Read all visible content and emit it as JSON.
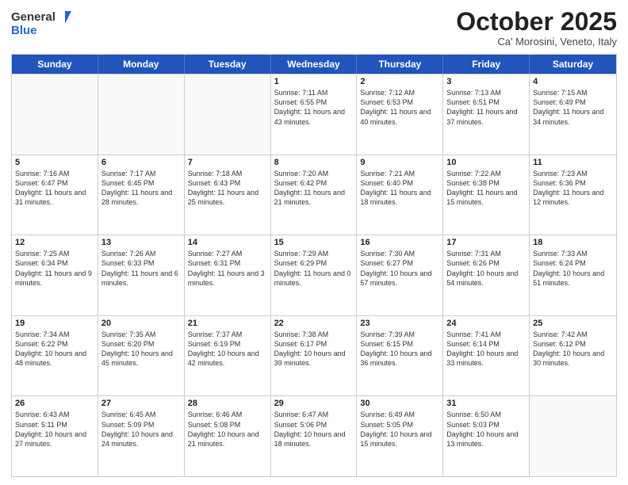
{
  "header": {
    "logo_line1": "General",
    "logo_line2": "Blue",
    "month": "October 2025",
    "location": "Ca' Morosini, Veneto, Italy"
  },
  "days_of_week": [
    "Sunday",
    "Monday",
    "Tuesday",
    "Wednesday",
    "Thursday",
    "Friday",
    "Saturday"
  ],
  "weeks": [
    [
      {
        "day": "",
        "sunrise": "",
        "sunset": "",
        "daylight": ""
      },
      {
        "day": "",
        "sunrise": "",
        "sunset": "",
        "daylight": ""
      },
      {
        "day": "",
        "sunrise": "",
        "sunset": "",
        "daylight": ""
      },
      {
        "day": "1",
        "sunrise": "Sunrise: 7:11 AM",
        "sunset": "Sunset: 6:55 PM",
        "daylight": "Daylight: 11 hours and 43 minutes."
      },
      {
        "day": "2",
        "sunrise": "Sunrise: 7:12 AM",
        "sunset": "Sunset: 6:53 PM",
        "daylight": "Daylight: 11 hours and 40 minutes."
      },
      {
        "day": "3",
        "sunrise": "Sunrise: 7:13 AM",
        "sunset": "Sunset: 6:51 PM",
        "daylight": "Daylight: 11 hours and 37 minutes."
      },
      {
        "day": "4",
        "sunrise": "Sunrise: 7:15 AM",
        "sunset": "Sunset: 6:49 PM",
        "daylight": "Daylight: 11 hours and 34 minutes."
      }
    ],
    [
      {
        "day": "5",
        "sunrise": "Sunrise: 7:16 AM",
        "sunset": "Sunset: 6:47 PM",
        "daylight": "Daylight: 11 hours and 31 minutes."
      },
      {
        "day": "6",
        "sunrise": "Sunrise: 7:17 AM",
        "sunset": "Sunset: 6:45 PM",
        "daylight": "Daylight: 11 hours and 28 minutes."
      },
      {
        "day": "7",
        "sunrise": "Sunrise: 7:18 AM",
        "sunset": "Sunset: 6:43 PM",
        "daylight": "Daylight: 11 hours and 25 minutes."
      },
      {
        "day": "8",
        "sunrise": "Sunrise: 7:20 AM",
        "sunset": "Sunset: 6:42 PM",
        "daylight": "Daylight: 11 hours and 21 minutes."
      },
      {
        "day": "9",
        "sunrise": "Sunrise: 7:21 AM",
        "sunset": "Sunset: 6:40 PM",
        "daylight": "Daylight: 11 hours and 18 minutes."
      },
      {
        "day": "10",
        "sunrise": "Sunrise: 7:22 AM",
        "sunset": "Sunset: 6:38 PM",
        "daylight": "Daylight: 11 hours and 15 minutes."
      },
      {
        "day": "11",
        "sunrise": "Sunrise: 7:23 AM",
        "sunset": "Sunset: 6:36 PM",
        "daylight": "Daylight: 11 hours and 12 minutes."
      }
    ],
    [
      {
        "day": "12",
        "sunrise": "Sunrise: 7:25 AM",
        "sunset": "Sunset: 6:34 PM",
        "daylight": "Daylight: 11 hours and 9 minutes."
      },
      {
        "day": "13",
        "sunrise": "Sunrise: 7:26 AM",
        "sunset": "Sunset: 6:33 PM",
        "daylight": "Daylight: 11 hours and 6 minutes."
      },
      {
        "day": "14",
        "sunrise": "Sunrise: 7:27 AM",
        "sunset": "Sunset: 6:31 PM",
        "daylight": "Daylight: 11 hours and 3 minutes."
      },
      {
        "day": "15",
        "sunrise": "Sunrise: 7:29 AM",
        "sunset": "Sunset: 6:29 PM",
        "daylight": "Daylight: 11 hours and 0 minutes."
      },
      {
        "day": "16",
        "sunrise": "Sunrise: 7:30 AM",
        "sunset": "Sunset: 6:27 PM",
        "daylight": "Daylight: 10 hours and 57 minutes."
      },
      {
        "day": "17",
        "sunrise": "Sunrise: 7:31 AM",
        "sunset": "Sunset: 6:26 PM",
        "daylight": "Daylight: 10 hours and 54 minutes."
      },
      {
        "day": "18",
        "sunrise": "Sunrise: 7:33 AM",
        "sunset": "Sunset: 6:24 PM",
        "daylight": "Daylight: 10 hours and 51 minutes."
      }
    ],
    [
      {
        "day": "19",
        "sunrise": "Sunrise: 7:34 AM",
        "sunset": "Sunset: 6:22 PM",
        "daylight": "Daylight: 10 hours and 48 minutes."
      },
      {
        "day": "20",
        "sunrise": "Sunrise: 7:35 AM",
        "sunset": "Sunset: 6:20 PM",
        "daylight": "Daylight: 10 hours and 45 minutes."
      },
      {
        "day": "21",
        "sunrise": "Sunrise: 7:37 AM",
        "sunset": "Sunset: 6:19 PM",
        "daylight": "Daylight: 10 hours and 42 minutes."
      },
      {
        "day": "22",
        "sunrise": "Sunrise: 7:38 AM",
        "sunset": "Sunset: 6:17 PM",
        "daylight": "Daylight: 10 hours and 39 minutes."
      },
      {
        "day": "23",
        "sunrise": "Sunrise: 7:39 AM",
        "sunset": "Sunset: 6:15 PM",
        "daylight": "Daylight: 10 hours and 36 minutes."
      },
      {
        "day": "24",
        "sunrise": "Sunrise: 7:41 AM",
        "sunset": "Sunset: 6:14 PM",
        "daylight": "Daylight: 10 hours and 33 minutes."
      },
      {
        "day": "25",
        "sunrise": "Sunrise: 7:42 AM",
        "sunset": "Sunset: 6:12 PM",
        "daylight": "Daylight: 10 hours and 30 minutes."
      }
    ],
    [
      {
        "day": "26",
        "sunrise": "Sunrise: 6:43 AM",
        "sunset": "Sunset: 5:11 PM",
        "daylight": "Daylight: 10 hours and 27 minutes."
      },
      {
        "day": "27",
        "sunrise": "Sunrise: 6:45 AM",
        "sunset": "Sunset: 5:09 PM",
        "daylight": "Daylight: 10 hours and 24 minutes."
      },
      {
        "day": "28",
        "sunrise": "Sunrise: 6:46 AM",
        "sunset": "Sunset: 5:08 PM",
        "daylight": "Daylight: 10 hours and 21 minutes."
      },
      {
        "day": "29",
        "sunrise": "Sunrise: 6:47 AM",
        "sunset": "Sunset: 5:06 PM",
        "daylight": "Daylight: 10 hours and 18 minutes."
      },
      {
        "day": "30",
        "sunrise": "Sunrise: 6:49 AM",
        "sunset": "Sunset: 5:05 PM",
        "daylight": "Daylight: 10 hours and 15 minutes."
      },
      {
        "day": "31",
        "sunrise": "Sunrise: 6:50 AM",
        "sunset": "Sunset: 5:03 PM",
        "daylight": "Daylight: 10 hours and 13 minutes."
      },
      {
        "day": "",
        "sunrise": "",
        "sunset": "",
        "daylight": ""
      }
    ]
  ]
}
